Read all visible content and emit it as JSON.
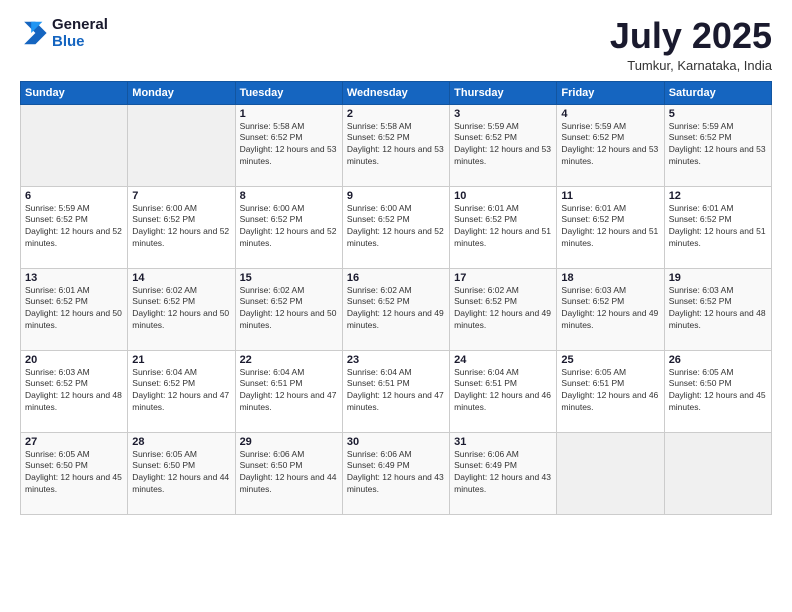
{
  "header": {
    "logo_line1": "General",
    "logo_line2": "Blue",
    "month": "July 2025",
    "location": "Tumkur, Karnataka, India"
  },
  "weekdays": [
    "Sunday",
    "Monday",
    "Tuesday",
    "Wednesday",
    "Thursday",
    "Friday",
    "Saturday"
  ],
  "weeks": [
    [
      {
        "day": "",
        "info": ""
      },
      {
        "day": "",
        "info": ""
      },
      {
        "day": "1",
        "info": "Sunrise: 5:58 AM\nSunset: 6:52 PM\nDaylight: 12 hours and 53 minutes."
      },
      {
        "day": "2",
        "info": "Sunrise: 5:58 AM\nSunset: 6:52 PM\nDaylight: 12 hours and 53 minutes."
      },
      {
        "day": "3",
        "info": "Sunrise: 5:59 AM\nSunset: 6:52 PM\nDaylight: 12 hours and 53 minutes."
      },
      {
        "day": "4",
        "info": "Sunrise: 5:59 AM\nSunset: 6:52 PM\nDaylight: 12 hours and 53 minutes."
      },
      {
        "day": "5",
        "info": "Sunrise: 5:59 AM\nSunset: 6:52 PM\nDaylight: 12 hours and 53 minutes."
      }
    ],
    [
      {
        "day": "6",
        "info": "Sunrise: 5:59 AM\nSunset: 6:52 PM\nDaylight: 12 hours and 52 minutes."
      },
      {
        "day": "7",
        "info": "Sunrise: 6:00 AM\nSunset: 6:52 PM\nDaylight: 12 hours and 52 minutes."
      },
      {
        "day": "8",
        "info": "Sunrise: 6:00 AM\nSunset: 6:52 PM\nDaylight: 12 hours and 52 minutes."
      },
      {
        "day": "9",
        "info": "Sunrise: 6:00 AM\nSunset: 6:52 PM\nDaylight: 12 hours and 52 minutes."
      },
      {
        "day": "10",
        "info": "Sunrise: 6:01 AM\nSunset: 6:52 PM\nDaylight: 12 hours and 51 minutes."
      },
      {
        "day": "11",
        "info": "Sunrise: 6:01 AM\nSunset: 6:52 PM\nDaylight: 12 hours and 51 minutes."
      },
      {
        "day": "12",
        "info": "Sunrise: 6:01 AM\nSunset: 6:52 PM\nDaylight: 12 hours and 51 minutes."
      }
    ],
    [
      {
        "day": "13",
        "info": "Sunrise: 6:01 AM\nSunset: 6:52 PM\nDaylight: 12 hours and 50 minutes."
      },
      {
        "day": "14",
        "info": "Sunrise: 6:02 AM\nSunset: 6:52 PM\nDaylight: 12 hours and 50 minutes."
      },
      {
        "day": "15",
        "info": "Sunrise: 6:02 AM\nSunset: 6:52 PM\nDaylight: 12 hours and 50 minutes."
      },
      {
        "day": "16",
        "info": "Sunrise: 6:02 AM\nSunset: 6:52 PM\nDaylight: 12 hours and 49 minutes."
      },
      {
        "day": "17",
        "info": "Sunrise: 6:02 AM\nSunset: 6:52 PM\nDaylight: 12 hours and 49 minutes."
      },
      {
        "day": "18",
        "info": "Sunrise: 6:03 AM\nSunset: 6:52 PM\nDaylight: 12 hours and 49 minutes."
      },
      {
        "day": "19",
        "info": "Sunrise: 6:03 AM\nSunset: 6:52 PM\nDaylight: 12 hours and 48 minutes."
      }
    ],
    [
      {
        "day": "20",
        "info": "Sunrise: 6:03 AM\nSunset: 6:52 PM\nDaylight: 12 hours and 48 minutes."
      },
      {
        "day": "21",
        "info": "Sunrise: 6:04 AM\nSunset: 6:52 PM\nDaylight: 12 hours and 47 minutes."
      },
      {
        "day": "22",
        "info": "Sunrise: 6:04 AM\nSunset: 6:51 PM\nDaylight: 12 hours and 47 minutes."
      },
      {
        "day": "23",
        "info": "Sunrise: 6:04 AM\nSunset: 6:51 PM\nDaylight: 12 hours and 47 minutes."
      },
      {
        "day": "24",
        "info": "Sunrise: 6:04 AM\nSunset: 6:51 PM\nDaylight: 12 hours and 46 minutes."
      },
      {
        "day": "25",
        "info": "Sunrise: 6:05 AM\nSunset: 6:51 PM\nDaylight: 12 hours and 46 minutes."
      },
      {
        "day": "26",
        "info": "Sunrise: 6:05 AM\nSunset: 6:50 PM\nDaylight: 12 hours and 45 minutes."
      }
    ],
    [
      {
        "day": "27",
        "info": "Sunrise: 6:05 AM\nSunset: 6:50 PM\nDaylight: 12 hours and 45 minutes."
      },
      {
        "day": "28",
        "info": "Sunrise: 6:05 AM\nSunset: 6:50 PM\nDaylight: 12 hours and 44 minutes."
      },
      {
        "day": "29",
        "info": "Sunrise: 6:06 AM\nSunset: 6:50 PM\nDaylight: 12 hours and 44 minutes."
      },
      {
        "day": "30",
        "info": "Sunrise: 6:06 AM\nSunset: 6:49 PM\nDaylight: 12 hours and 43 minutes."
      },
      {
        "day": "31",
        "info": "Sunrise: 6:06 AM\nSunset: 6:49 PM\nDaylight: 12 hours and 43 minutes."
      },
      {
        "day": "",
        "info": ""
      },
      {
        "day": "",
        "info": ""
      }
    ]
  ]
}
